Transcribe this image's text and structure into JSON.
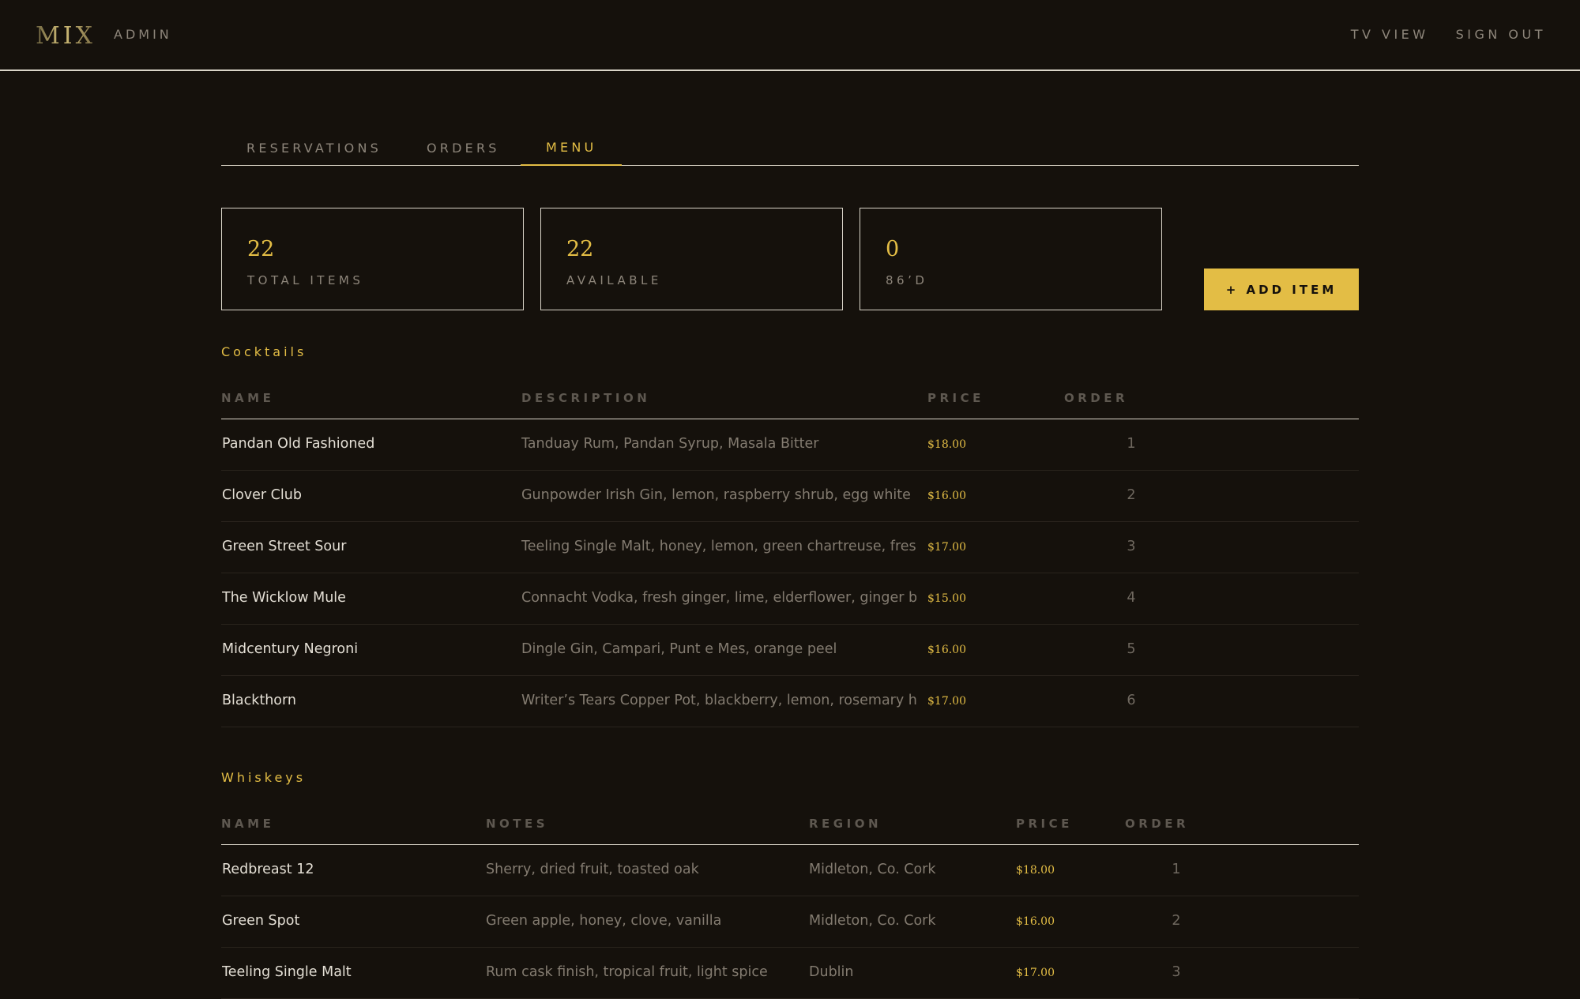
{
  "header": {
    "logo": "MIX",
    "admin_label": "ADMIN",
    "nav": [
      "TV VIEW",
      "SIGN OUT"
    ]
  },
  "tabs": [
    "RESERVATIONS",
    "ORDERS",
    "MENU"
  ],
  "active_tab": "MENU",
  "stats": [
    {
      "value": "22",
      "label": "TOTAL ITEMS"
    },
    {
      "value": "22",
      "label": "AVAILABLE"
    },
    {
      "value": "0",
      "label": "86’D"
    }
  ],
  "add_item_label": "+ ADD ITEM",
  "cocktails": {
    "title": "Cocktails",
    "columns": [
      "NAME",
      "DESCRIPTION",
      "PRICE",
      "ORDER"
    ],
    "rows": [
      {
        "name": "Pandan Old Fashioned",
        "description": "Tanduay Rum, Pandan Syrup, Masala Bitter",
        "price": "$18.00",
        "order": "1"
      },
      {
        "name": "Clover Club",
        "description": "Gunpowder Irish Gin, lemon, raspberry shrub, egg white",
        "price": "$16.00",
        "order": "2"
      },
      {
        "name": "Green Street Sour",
        "description": "Teeling Single Malt, honey, lemon, green chartreuse, fresh thy…",
        "price": "$17.00",
        "order": "3"
      },
      {
        "name": "The Wicklow Mule",
        "description": "Connacht Vodka, fresh ginger, lime, elderflower, ginger beer",
        "price": "$15.00",
        "order": "4"
      },
      {
        "name": "Midcentury Negroni",
        "description": "Dingle Gin, Campari, Punt e Mes, orange peel",
        "price": "$16.00",
        "order": "5"
      },
      {
        "name": "Blackthorn",
        "description": "Writer’s Tears Copper Pot, blackberry, lemon, rosemary honey",
        "price": "$17.00",
        "order": "6"
      }
    ]
  },
  "whiskeys": {
    "title": "Whiskeys",
    "columns": [
      "NAME",
      "NOTES",
      "REGION",
      "PRICE",
      "ORDER"
    ],
    "rows": [
      {
        "name": "Redbreast 12",
        "notes": "Sherry, dried fruit, toasted oak",
        "region": "Midleton, Co. Cork",
        "price": "$18.00",
        "order": "1"
      },
      {
        "name": "Green Spot",
        "notes": "Green apple, honey, clove, vanilla",
        "region": "Midleton, Co. Cork",
        "price": "$16.00",
        "order": "2"
      },
      {
        "name": "Teeling Single Malt",
        "notes": "Rum cask finish, tropical fruit, light spice",
        "region": "Dublin",
        "price": "$17.00",
        "order": "3"
      }
    ]
  },
  "colors": {
    "background": "#15110c",
    "accent": "#e3bd45",
    "border": "#d9d4c8",
    "muted_text": "#8d857a"
  }
}
